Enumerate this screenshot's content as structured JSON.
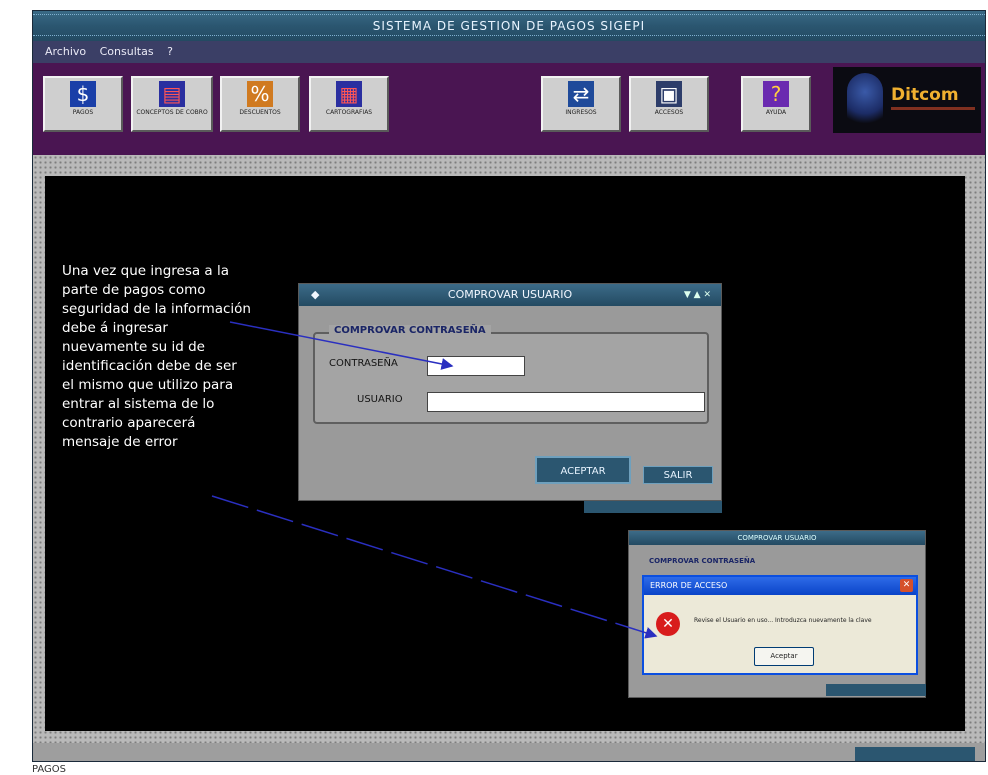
{
  "window": {
    "title": "SISTEMA DE GESTION DE PAGOS SIGEPI"
  },
  "menu": [
    "Archivo",
    "Consultas",
    "?"
  ],
  "toolbar_left": [
    {
      "label": "PAGOS",
      "icon": "dollar-document-icon"
    },
    {
      "label": "CONCEPTOS DE COBRO",
      "icon": "ledger-icon"
    },
    {
      "label": "DESCUENTOS",
      "icon": "discount-icon"
    },
    {
      "label": "CARTOGRAFIAS",
      "icon": "building-icon"
    }
  ],
  "toolbar_right": [
    {
      "label": "INGRESOS",
      "icon": "network-icon"
    },
    {
      "label": "ACCESOS",
      "icon": "monitor-icon"
    },
    {
      "label": "AYUDA",
      "icon": "help-book-icon"
    }
  ],
  "logo": {
    "text": "Ditcom"
  },
  "annotation": "Una vez que ingresa a la parte de pagos como seguridad de la información debe á ingresar nuevamente su id de identificación debe de ser el mismo que utilizo para entrar al sistema de lo contrario aparecerá mensaje de error",
  "dialog": {
    "title": "COMPROVAR USUARIO",
    "group_label": "COMPROVAR CONTRASEÑA",
    "password_label": "CONTRASEÑA",
    "user_label": "USUARIO",
    "password_value": "",
    "user_value": "",
    "accept_label": "ACEPTAR",
    "exit_label": "SALIR"
  },
  "mini_dialog": {
    "title": "COMPROVAR USUARIO",
    "group_label": "COMPROVAR CONTRASEÑA"
  },
  "error_dialog": {
    "title": "ERROR DE ACCESO",
    "message": "Revise el Usuario en uso... Introduzca nuevamente la clave",
    "ok_label": "Aceptar"
  },
  "footer": {
    "text": "PAGOS"
  },
  "colors": {
    "titlebar": "#2b5670",
    "toolbar": "#4a1552",
    "desktop": "#000000",
    "arrow": "#2a2fc0"
  }
}
